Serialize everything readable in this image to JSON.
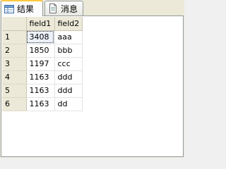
{
  "tabs": [
    {
      "label": "结果",
      "icon": "grid-icon",
      "active": true
    },
    {
      "label": "消息",
      "icon": "document-icon",
      "active": false
    }
  ],
  "grid": {
    "columns": [
      "field1",
      "field2"
    ],
    "rows": [
      {
        "num": "1",
        "field1": "3408",
        "field2": "aaa"
      },
      {
        "num": "2",
        "field1": "1850",
        "field2": "bbb"
      },
      {
        "num": "3",
        "field1": "1197",
        "field2": "ccc"
      },
      {
        "num": "4",
        "field1": "1163",
        "field2": "ddd"
      },
      {
        "num": "5",
        "field1": "1163",
        "field2": "ddd"
      },
      {
        "num": "6",
        "field1": "1163",
        "field2": "dd"
      }
    ]
  }
}
